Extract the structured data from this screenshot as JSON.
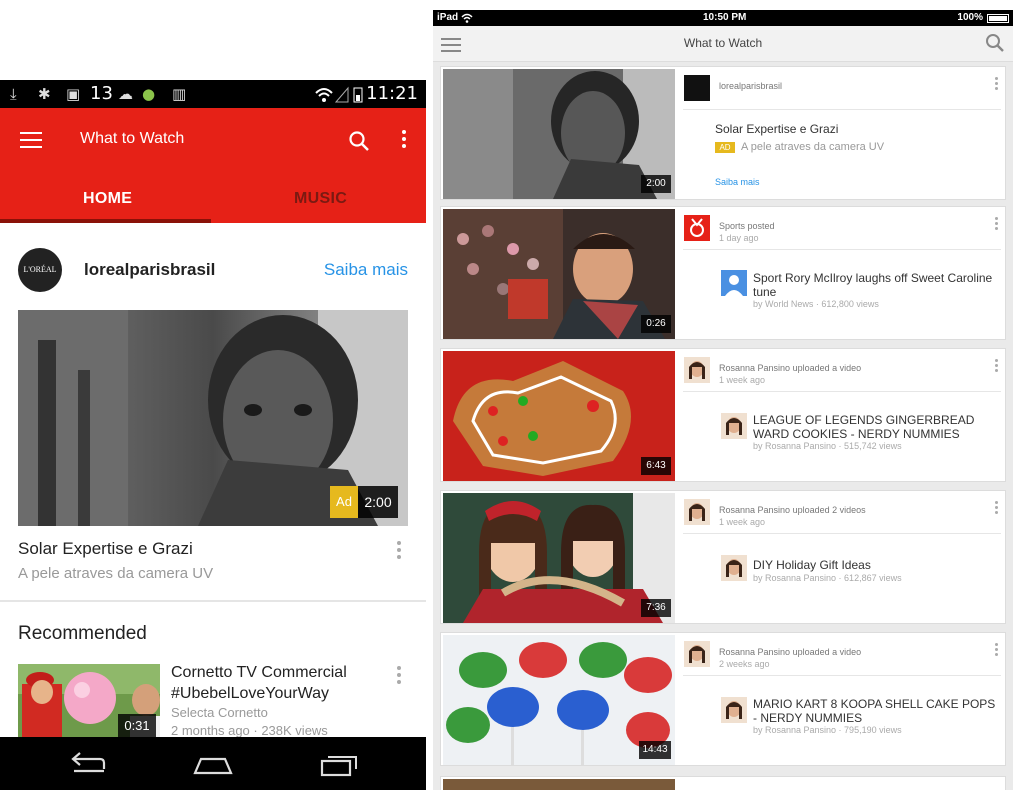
{
  "android": {
    "status_bar": {
      "notification_count": "13",
      "time": "11:21"
    },
    "app_bar": {
      "title": "What to Watch"
    },
    "tabs": [
      {
        "label": "HOME",
        "selected": true
      },
      {
        "label": "MUSIC",
        "selected": false
      }
    ],
    "promoted": {
      "avatar_text": "L'ORÉAL",
      "channel": "lorealparisbrasil",
      "action": "Saiba mais",
      "ad_label": "Ad",
      "duration": "2:00",
      "title": "Solar Expertise e Grazi",
      "subtitle": "A pele atraves da camera UV"
    },
    "section_title": "Recommended",
    "recommended": [
      {
        "title": "Cornetto TV Commercial #UbebelLoveYourWay",
        "channel": "Selecta Cornetto",
        "meta": "2 months ago · 238K views",
        "duration": "0:31"
      }
    ]
  },
  "ipad": {
    "status_bar": {
      "device": "iPad",
      "time": "10:50 PM",
      "battery": "100%"
    },
    "title": "What to Watch",
    "cards": [
      {
        "type": "ad",
        "poster": "lorealparisbrasil",
        "title": "Solar Expertise e Grazi",
        "ad_label": "AD",
        "subtitle": "A pele atraves da camera UV",
        "action": "Saiba mais",
        "duration": "2:00"
      },
      {
        "poster": "Sports",
        "verb": " posted",
        "when": "1 day ago",
        "title": "Sport   Rory McIlroy laughs off Sweet Caroline tune",
        "byline": "by World News · 612,800 views",
        "duration": "0:26"
      },
      {
        "poster": "Rosanna Pansino",
        "verb": " uploaded a video",
        "when": "1 week ago",
        "title": "LEAGUE OF LEGENDS GINGERBREAD WARD COOKIES - NERDY NUMMIES",
        "byline": "by Rosanna Pansino · 515,742 views",
        "duration": "6:43"
      },
      {
        "poster": "Rosanna Pansino",
        "verb": " uploaded 2 videos",
        "when": "1 week ago",
        "title": "DIY Holiday Gift Ideas",
        "byline": "by Rosanna Pansino · 612,867 views",
        "duration": "7:36"
      },
      {
        "poster": "Rosanna Pansino",
        "verb": " uploaded a video",
        "when": "2 weeks ago",
        "title": "MARIO KART 8 KOOPA SHELL CAKE POPS - NERDY NUMMIES",
        "byline": "by Rosanna Pansino · 795,190 views",
        "duration": "14:43"
      }
    ]
  },
  "colors": {
    "youtube_red": "#e62117",
    "tab_indicator": "#8a1108",
    "link_blue": "#2793e6",
    "ad_yellow": "#e6b91e"
  }
}
